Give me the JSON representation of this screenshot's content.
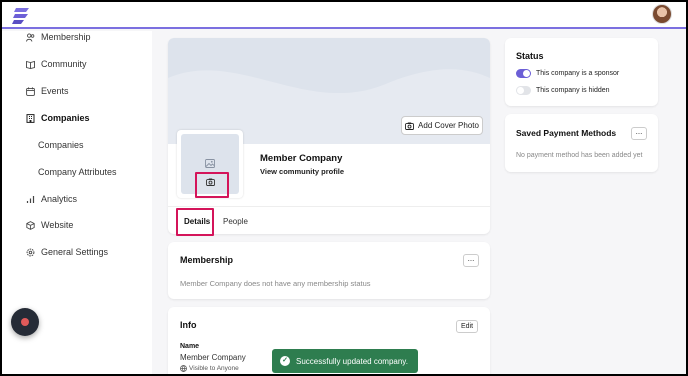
{
  "sidebar": {
    "items": [
      {
        "label": "Membership",
        "icon": "users-icon"
      },
      {
        "label": "Community",
        "icon": "book-icon"
      },
      {
        "label": "Events",
        "icon": "calendar-icon"
      },
      {
        "label": "Companies",
        "icon": "building-icon"
      },
      {
        "label": "Companies",
        "icon": ""
      },
      {
        "label": "Company Attributes",
        "icon": ""
      },
      {
        "label": "Analytics",
        "icon": "bar-chart-icon"
      },
      {
        "label": "Website",
        "icon": "cube-icon"
      },
      {
        "label": "General Settings",
        "icon": "gear-icon"
      }
    ]
  },
  "company": {
    "add_cover_label": "Add Cover Photo",
    "name": "Member Company",
    "view_profile": "View community profile",
    "tabs": [
      "Details",
      "People"
    ]
  },
  "membership": {
    "title": "Membership",
    "dots": "...",
    "empty": "Member Company does not have any membership status"
  },
  "info": {
    "title": "Info",
    "edit": "Edit",
    "name_label": "Name",
    "name_value": "Member Company",
    "visibility": "Visible to Anyone"
  },
  "status": {
    "title": "Status",
    "sponsor_label": "This company is a sponsor",
    "hidden_label": "This company is hidden",
    "sponsor_on": true,
    "hidden_on": false,
    "accent": "#6c5fd6"
  },
  "payment": {
    "title": "Saved Payment Methods",
    "dots": "...",
    "empty": "No payment method has been added yet"
  },
  "toast": {
    "message": "Successfully updated company."
  }
}
